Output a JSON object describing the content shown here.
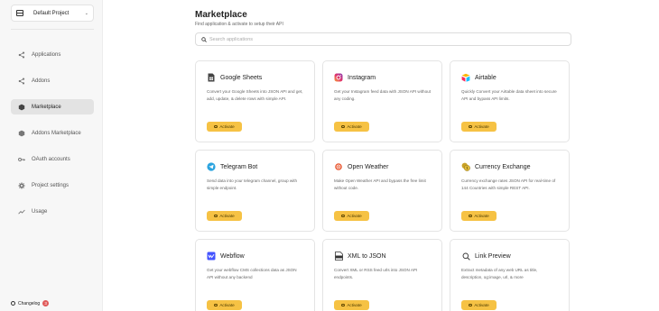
{
  "sidebar": {
    "project": {
      "name": "Default Project",
      "chevron": "⌄"
    },
    "items": [
      {
        "label": "Applications",
        "icon": "share-icon",
        "active": false
      },
      {
        "label": "Addons",
        "icon": "share-icon",
        "active": false
      },
      {
        "label": "Marketplace",
        "icon": "cube-icon",
        "active": true
      },
      {
        "label": "Addons Marketplace",
        "icon": "cube-icon",
        "active": false
      },
      {
        "label": "OAuth accounts",
        "icon": "key-icon",
        "active": false
      },
      {
        "label": "Project settings",
        "icon": "gear-icon",
        "active": false
      },
      {
        "label": "Usage",
        "icon": "trend-icon",
        "active": false
      }
    ],
    "changelog": {
      "label": "Changelog",
      "badge": "3"
    }
  },
  "main": {
    "title": "Marketplace",
    "subtitle": "Find application & activate to setup their API",
    "search": {
      "placeholder": "Search applications"
    },
    "activate_label": "Activate",
    "cards": [
      {
        "name": "Google Sheets",
        "icon": "google-sheets-icon",
        "color": "#444444",
        "description": "Convert your Google Sheets into JSON API and get, add, update, & delete rows with simple API."
      },
      {
        "name": "Instagram",
        "icon": "instagram-icon",
        "color": "#d6336c",
        "description": "Get your Instagram feed data with JSON API without any coding."
      },
      {
        "name": "Airtable",
        "icon": "airtable-icon",
        "color": "#fcb400",
        "description": "Quickly Convert your Airtable data sheet into secure API and bypass API limits."
      },
      {
        "name": "Telegram Bot",
        "icon": "telegram-icon",
        "color": "#2aa3df",
        "description": "Send data into your telegram channel, group with simple endpoint."
      },
      {
        "name": "Open Weather",
        "icon": "weather-icon",
        "color": "#e8552e",
        "description": "Make Open Weather API and bypass the free limit without code."
      },
      {
        "name": "Currency Exchange",
        "icon": "currency-icon",
        "color": "#c9a227",
        "description": "Currency exchange rates JSON API for real-time of 144 Countries with simple REST API."
      },
      {
        "name": "Webflow",
        "icon": "webflow-icon",
        "color": "#4353ff",
        "description": "Get your webflow CMS collections data as JSON API without any backend"
      },
      {
        "name": "XML to JSON",
        "icon": "xml-file-icon",
        "color": "#333333",
        "description": "Convert XML or RSS feed urls into JSON API endpoints."
      },
      {
        "name": "Link Preview",
        "icon": "search-icon",
        "color": "#333333",
        "description": "Extract metadata of any web URL as title, description, og:image, url, & more"
      }
    ]
  }
}
